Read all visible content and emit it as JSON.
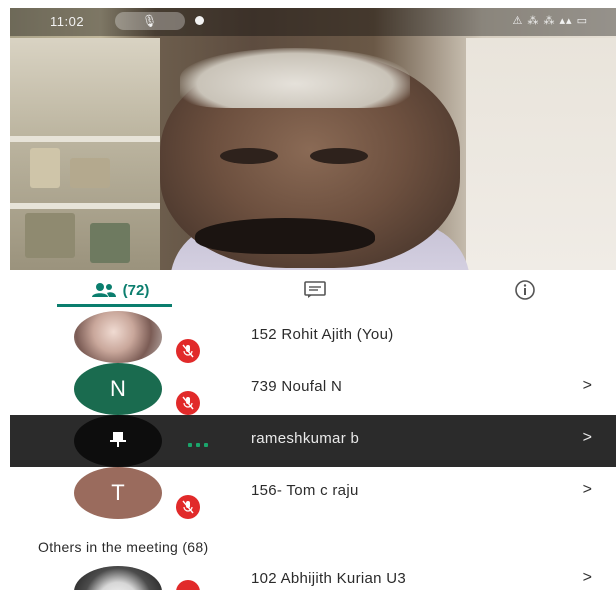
{
  "status_bar": {
    "time": "11:02",
    "right_indicators": "⚠ ⁂ ⁂ ▴▴ ▭"
  },
  "tabs": {
    "people_count": "(72)",
    "accent_color": "#0b7e6e"
  },
  "participants": [
    {
      "name": "152 Rohit Ajith (You)",
      "avatar": "photo",
      "muted": true,
      "chevron": ""
    },
    {
      "name": "739 Noufal N",
      "avatar_letter": "N",
      "avatar_color": "#1a6b4f",
      "muted": true,
      "chevron": ">"
    },
    {
      "name": "rameshkumar b",
      "avatar": "pin-icon",
      "muted": false,
      "speaking": true,
      "chevron": ">"
    },
    {
      "name": "156- Tom c raju",
      "avatar_letter": "T",
      "avatar_color": "#9a6b5d",
      "muted": true,
      "chevron": ">"
    }
  ],
  "others_section": {
    "title": "Others in the meeting (68)",
    "participants": [
      {
        "name": "102 Abhijith Kurian U3",
        "avatar": "photo",
        "muted": true,
        "chevron": ">"
      }
    ]
  }
}
